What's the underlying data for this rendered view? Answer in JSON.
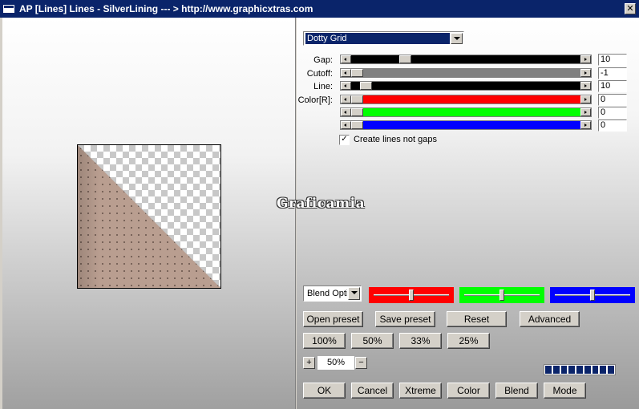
{
  "window": {
    "title": "AP [Lines]  Lines - SilverLining    --- > http://www.graphicxtras.com",
    "close_glyph": "✕"
  },
  "watermark": "Graficamia",
  "effect_dropdown": {
    "value": "Dotty Grid"
  },
  "sliders": [
    {
      "label": "Gap:",
      "value": "10",
      "fill_color": "#000000",
      "thumb_position": 0.22
    },
    {
      "label": "Cutoff:",
      "value": "-1",
      "fill_color": "#808080",
      "thumb_position": 0.0
    },
    {
      "label": "Line:",
      "value": "10",
      "fill_color": "#000000",
      "thumb_position": 0.04
    },
    {
      "label": "Color[R]:",
      "value": "0",
      "fill_color": "#ff0000",
      "thumb_position": 0.0
    },
    {
      "label": "",
      "value": "0",
      "fill_color": "#00ff00",
      "thumb_position": 0.0
    },
    {
      "label": "",
      "value": "0",
      "fill_color": "#0000ff",
      "thumb_position": 0.0
    }
  ],
  "create_lines_checkbox": {
    "label": "Create lines not gaps",
    "checked": true,
    "glyph": "✓"
  },
  "blend_dropdown": {
    "value": "Blend Optic"
  },
  "blend_swatches": [
    {
      "color": "#ff0000",
      "thumb_position": 0.5
    },
    {
      "color": "#00ff00",
      "thumb_position": 0.5
    },
    {
      "color": "#0000ff",
      "thumb_position": 0.5
    }
  ],
  "preset_buttons": {
    "open": "Open preset",
    "save": "Save preset",
    "reset": "Reset",
    "advanced": "Advanced"
  },
  "zoom_buttons": [
    "100%",
    "50%",
    "33%",
    "25%"
  ],
  "zoom": {
    "plus": "+",
    "value": "50%",
    "minus": "−"
  },
  "progress_segments": 9,
  "bottom_buttons": [
    "OK",
    "Cancel",
    "Xtreme",
    "Color",
    "Blend",
    "Mode"
  ],
  "preview": {
    "fill_color": "#b99e90",
    "dot_color": "#4a3a33"
  }
}
